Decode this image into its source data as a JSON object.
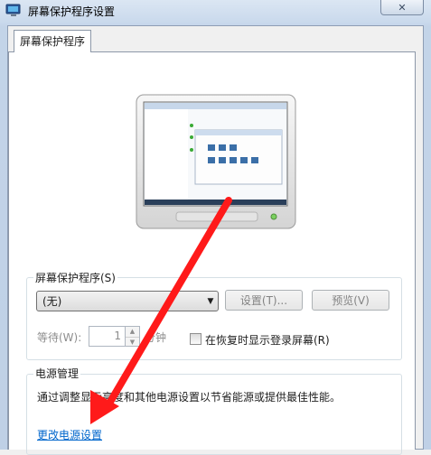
{
  "window": {
    "title": "屏幕保护程序设置",
    "close_symbol": "✕"
  },
  "tabs": [
    {
      "label": "屏幕保护程序"
    }
  ],
  "screensaver": {
    "group_label": "屏幕保护程序(S)",
    "selected": "(无)",
    "settings_button": "设置(T)...",
    "preview_button": "预览(V)",
    "wait_label": "等待(W):",
    "wait_value": "1",
    "minutes_label": "分钟",
    "resume_checkbox_label": "在恢复时显示登录屏幕(R)",
    "resume_checked": false
  },
  "power": {
    "group_label": "电源管理",
    "description": "通过调整显示亮度和其他电源设置以节省能源或提供最佳性能。",
    "link": "更改电源设置"
  },
  "colors": {
    "annotation_arrow": "#ff1a1a",
    "link": "#0066cc"
  }
}
